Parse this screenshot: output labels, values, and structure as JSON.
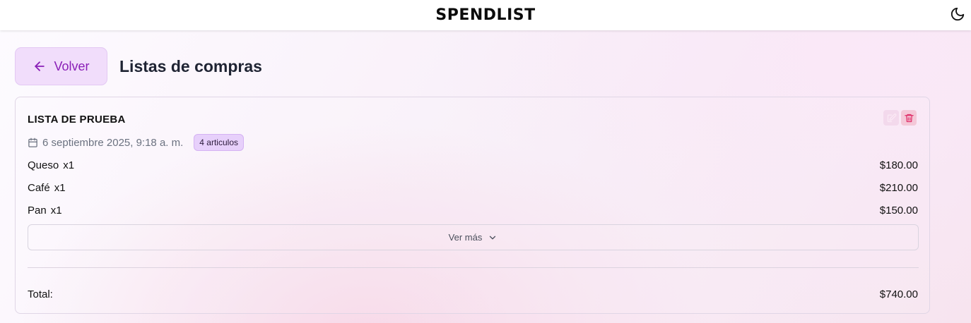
{
  "header": {
    "brand": "SPENDLIST",
    "theme_icon": "moon-icon"
  },
  "toolbar": {
    "back_label": "Volver",
    "back_icon": "arrow-left-icon",
    "page_title": "Listas de compras"
  },
  "list": {
    "name": "LISTA DE PRUEBA",
    "date": "6 septiembre 2025, 9:18 a. m.",
    "items_badge": "4 articulos",
    "items": [
      {
        "name": "Queso",
        "qty": "x1",
        "price": "$180.00"
      },
      {
        "name": "Café",
        "qty": "x1",
        "price": "$210.00"
      },
      {
        "name": "Pan",
        "qty": "x1",
        "price": "$150.00"
      }
    ],
    "more_label": "Ver más",
    "total_label": "Total:",
    "total_value": "$740.00"
  },
  "colors": {
    "accent": "#8a1fb7",
    "back_bg": "#f1ddfb",
    "delete": "#e0306a",
    "edit": "#d88bc4"
  }
}
